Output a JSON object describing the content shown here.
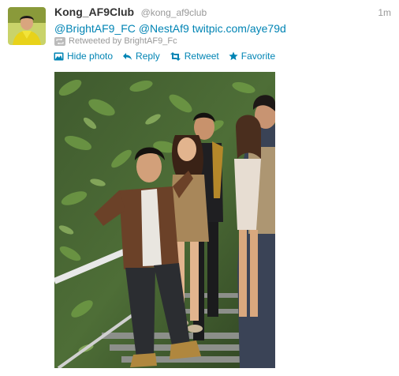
{
  "tweet": {
    "fullname": "Kong_AF9Club",
    "username": "@kong_af9club",
    "timestamp": "1m",
    "text": {
      "mention1": "@BrightAF9_FC",
      "mention2": "@NestAf9",
      "link": "twitpic.com/aye79d"
    },
    "retweeted_by": "Retweeted by BrightAF9_Fc"
  },
  "actions": {
    "hide_photo": "Hide photo",
    "reply": "Reply",
    "retweet": "Retweet",
    "favorite": "Favorite"
  },
  "icons": {
    "avatar": "profile-avatar",
    "retweeted": "retweet-badge-icon",
    "hide_photo": "photo-icon",
    "reply": "reply-arrow-icon",
    "retweet": "retweet-icon",
    "favorite": "star-icon"
  },
  "colors": {
    "link": "#0084b4",
    "muted": "#999999",
    "text": "#333333"
  }
}
